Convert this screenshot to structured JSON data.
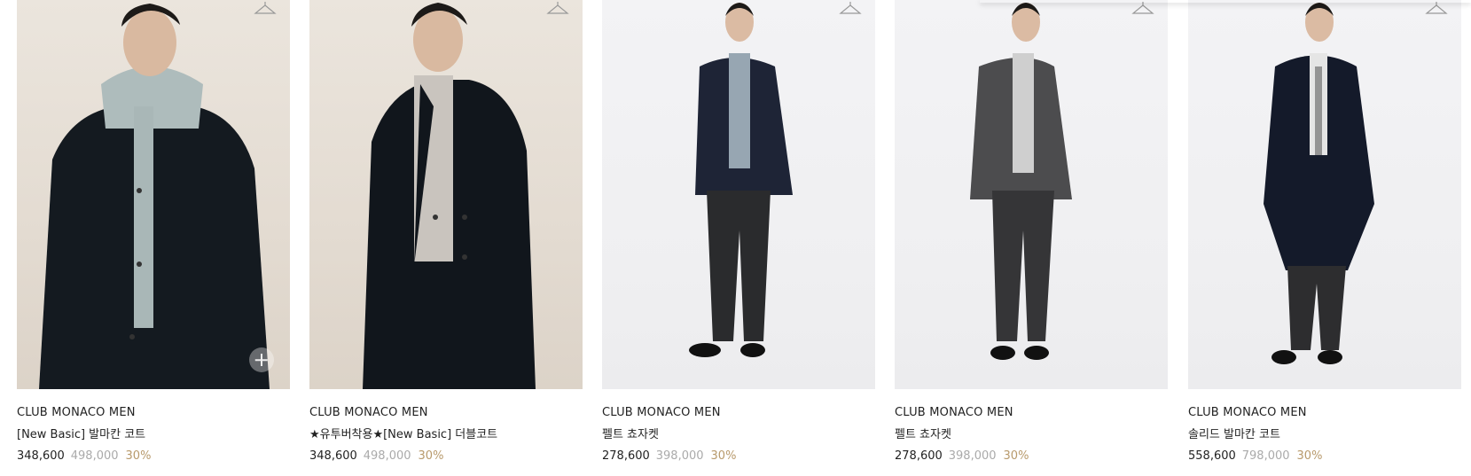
{
  "products": [
    {
      "brand": "CLUB MONACO MEN",
      "name": "[New Basic] 발마칸 코트",
      "price": "348,600",
      "original_price": "498,000",
      "discount": "30%",
      "image_alt": "model-dark-balmacaan-coat-hoodie"
    },
    {
      "brand": "CLUB MONACO MEN",
      "name": "★유투버착용★[New Basic] 더블코트",
      "price": "348,600",
      "original_price": "498,000",
      "discount": "30%",
      "image_alt": "model-double-coat-turtleneck"
    },
    {
      "brand": "CLUB MONACO MEN",
      "name": "펠트 쵸자켓",
      "price": "278,600",
      "original_price": "398,000",
      "discount": "30%",
      "image_alt": "model-navy-felt-jacket"
    },
    {
      "brand": "CLUB MONACO MEN",
      "name": "펠트 쵸자켓",
      "price": "278,600",
      "original_price": "398,000",
      "discount": "30%",
      "image_alt": "model-grey-felt-jacket"
    },
    {
      "brand": "CLUB MONACO MEN",
      "name": "솔리드 발마칸 코트",
      "price": "558,600",
      "original_price": "798,000",
      "discount": "30%",
      "image_alt": "model-navy-balmacaan-coat"
    }
  ],
  "colors": {
    "discount": "#b89a6c",
    "original_price": "#aaaaaa",
    "text": "#222222"
  },
  "icons": {
    "wishlist": "hanger-icon",
    "quick_add": "plus-icon"
  }
}
